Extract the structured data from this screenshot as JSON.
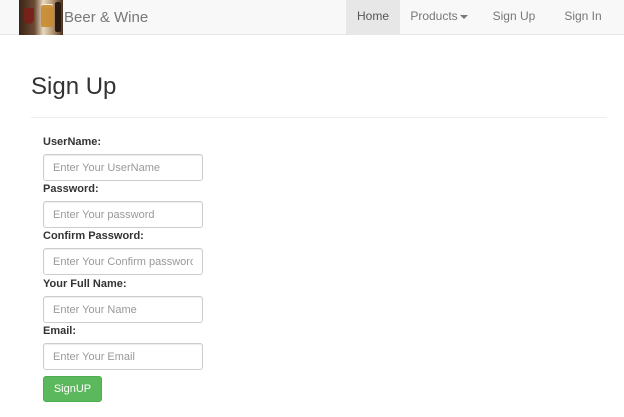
{
  "navbar": {
    "brand_name": "Beer & Wine",
    "items": [
      {
        "label": "Home",
        "active": true
      },
      {
        "label": "Products",
        "dropdown": true
      },
      {
        "label": "Sign Up"
      },
      {
        "label": "Sign In"
      }
    ]
  },
  "page": {
    "title": "Sign Up"
  },
  "form": {
    "fields": [
      {
        "label": "UserName:",
        "placeholder": "Enter Your UserName",
        "value": ""
      },
      {
        "label": "Password:",
        "placeholder": "Enter Your password",
        "value": ""
      },
      {
        "label": "Confirm Password:",
        "placeholder": "Enter Your Confirm password",
        "value": ""
      },
      {
        "label": "Your Full Name:",
        "placeholder": "Enter Your Name",
        "value": ""
      },
      {
        "label": "Email:",
        "placeholder": "Enter Your Email",
        "value": ""
      }
    ],
    "submit_label": "SignUP"
  },
  "colors": {
    "navbar_bg": "#f8f8f8",
    "active_nav_bg": "#e7e7e7",
    "submit_bg": "#5cb85c"
  },
  "icons": {
    "brand_logo": "beer-wine-logo-icon",
    "products_caret": "caret-down-icon"
  }
}
